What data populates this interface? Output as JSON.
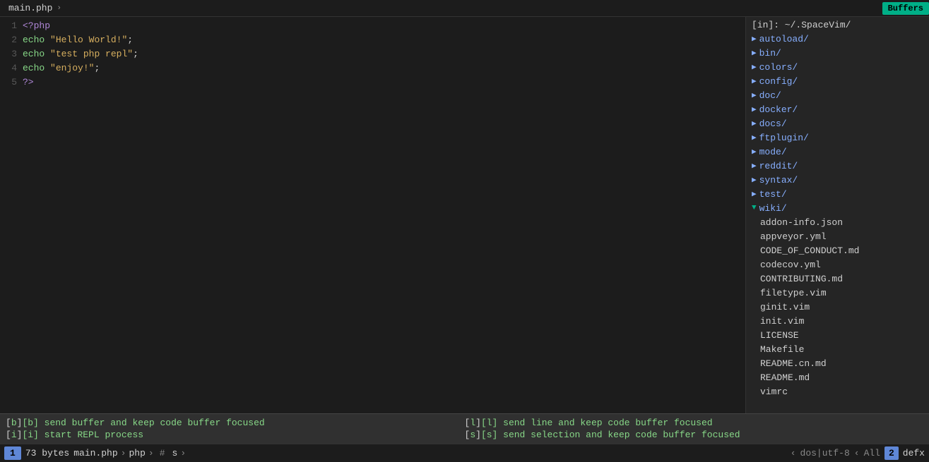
{
  "tab": {
    "filename": "main.php",
    "chevron": "›",
    "buffers_label": "Buffers"
  },
  "code": {
    "lines": [
      {
        "num": "1",
        "tokens": [
          {
            "t": "php-tag",
            "v": "<?php"
          }
        ]
      },
      {
        "num": "2",
        "tokens": [
          {
            "t": "php-func",
            "v": "echo"
          },
          {
            "t": "plain",
            "v": " "
          },
          {
            "t": "php-string",
            "v": "\"Hello World!\""
          },
          {
            "t": "plain",
            "v": ";"
          }
        ],
        "cursor_at": 0
      },
      {
        "num": "3",
        "tokens": [
          {
            "t": "php-func",
            "v": "echo"
          },
          {
            "t": "plain",
            "v": " "
          },
          {
            "t": "php-string",
            "v": "\"test php repl\""
          },
          {
            "t": "plain",
            "v": ";"
          }
        ]
      },
      {
        "num": "4",
        "tokens": [
          {
            "t": "php-func",
            "v": "echo"
          },
          {
            "t": "plain",
            "v": " "
          },
          {
            "t": "php-string",
            "v": "\"enjoy!\""
          },
          {
            "t": "plain",
            "v": ";"
          }
        ]
      },
      {
        "num": "5",
        "tokens": [
          {
            "t": "php-tag-close",
            "v": "?>"
          }
        ]
      }
    ]
  },
  "sidebar": {
    "header": "[in]: ~/.SpaceVim/",
    "items": [
      {
        "type": "dir",
        "label": "autoload/",
        "open": false,
        "indent": 0
      },
      {
        "type": "dir",
        "label": "bin/",
        "open": false,
        "indent": 0
      },
      {
        "type": "dir",
        "label": "colors/",
        "open": false,
        "indent": 0
      },
      {
        "type": "dir",
        "label": "config/",
        "open": false,
        "indent": 0
      },
      {
        "type": "dir",
        "label": "doc/",
        "open": false,
        "indent": 0
      },
      {
        "type": "dir",
        "label": "docker/",
        "open": false,
        "indent": 0
      },
      {
        "type": "dir",
        "label": "docs/",
        "open": false,
        "indent": 0
      },
      {
        "type": "dir",
        "label": "ftplugin/",
        "open": false,
        "indent": 0
      },
      {
        "type": "dir",
        "label": "mode/",
        "open": false,
        "indent": 0
      },
      {
        "type": "dir",
        "label": "reddit/",
        "open": false,
        "indent": 0
      },
      {
        "type": "dir",
        "label": "syntax/",
        "open": false,
        "indent": 0
      },
      {
        "type": "dir",
        "label": "test/",
        "open": false,
        "indent": 0
      },
      {
        "type": "dir",
        "label": "wiki/",
        "open": true,
        "indent": 0
      },
      {
        "type": "file",
        "label": "addon-info.json",
        "indent": 0
      },
      {
        "type": "file",
        "label": "appveyor.yml",
        "indent": 0
      },
      {
        "type": "file",
        "label": "CODE_OF_CONDUCT.md",
        "indent": 0
      },
      {
        "type": "file",
        "label": "codecov.yml",
        "indent": 0
      },
      {
        "type": "file",
        "label": "CONTRIBUTING.md",
        "indent": 0
      },
      {
        "type": "file",
        "label": "filetype.vim",
        "indent": 0
      },
      {
        "type": "file",
        "label": "ginit.vim",
        "indent": 0
      },
      {
        "type": "file",
        "label": "init.vim",
        "indent": 0
      },
      {
        "type": "file",
        "label": "LICENSE",
        "indent": 0
      },
      {
        "type": "file",
        "label": "Makefile",
        "indent": 0
      },
      {
        "type": "file",
        "label": "README.cn.md",
        "indent": 0
      },
      {
        "type": "file",
        "label": "README.md",
        "indent": 0
      },
      {
        "type": "file",
        "label": "vimrc",
        "indent": 0
      }
    ]
  },
  "hints": {
    "row1_left": "[b] send buffer and keep code buffer focused",
    "row1_right": "[l] send line and keep code buffer focused",
    "row2_left": "[i] start REPL process",
    "row2_right": "[s] send selection and keep code buffer focused"
  },
  "statusbar": {
    "mode": "1",
    "bytes": "73 bytes",
    "filename": "main.php",
    "chevron": "›",
    "lang": "php",
    "hash": "#",
    "cmd": "s",
    "chevron2": "›",
    "encoding": "dos|utf-8",
    "all": "All",
    "num": "2",
    "defx": "defx"
  }
}
